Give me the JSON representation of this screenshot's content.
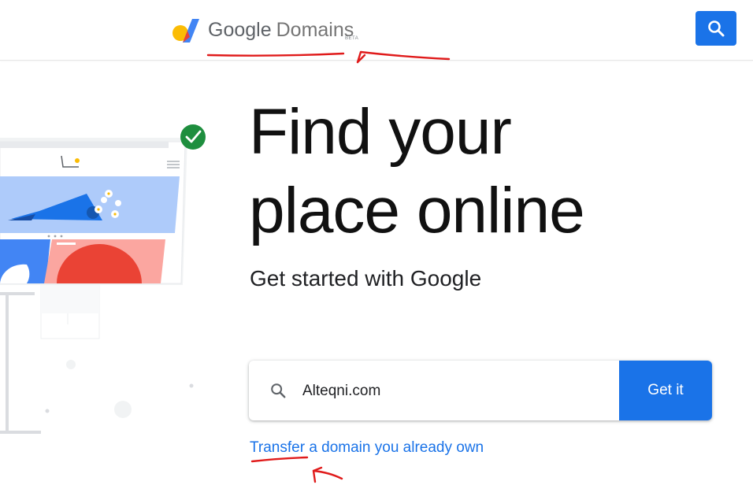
{
  "header": {
    "brand_google": "Google",
    "brand_product": "Domains",
    "beta_badge": "BETA",
    "search_button_icon": "search-icon"
  },
  "hero": {
    "headline_line1": "Find your",
    "headline_line2": "place online",
    "subheadline": "Get started with Google"
  },
  "domain_search": {
    "value": "Alteqni.com",
    "icon": "search-icon",
    "button_label": "Get it"
  },
  "transfer_link": {
    "label": "Transfer a domain you already own"
  },
  "colors": {
    "accent": "#1a73e8",
    "annotation": "#e01b1b",
    "check": "#1e8e3e"
  }
}
